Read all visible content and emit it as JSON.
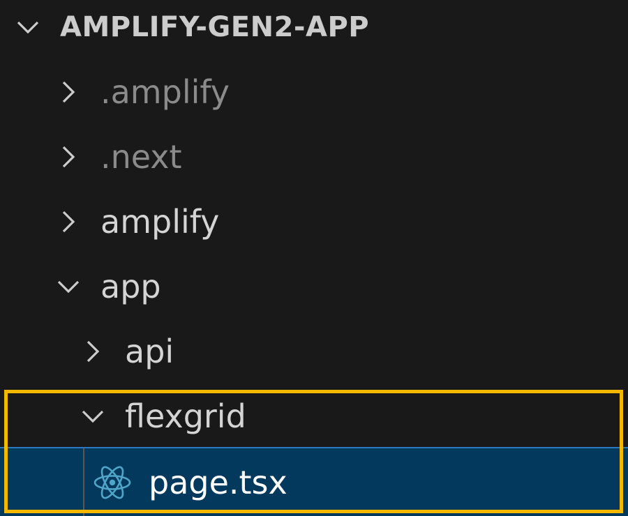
{
  "explorer": {
    "root": {
      "label": "AMPLIFY-GEN2-APP",
      "icon": "chevron-down-icon",
      "expanded": true
    },
    "items": [
      {
        "label": ".amplify",
        "icon": "chevron-right-icon",
        "expanded": false,
        "dimmed": true
      },
      {
        "label": ".next",
        "icon": "chevron-right-icon",
        "expanded": false,
        "dimmed": true
      },
      {
        "label": "amplify",
        "icon": "chevron-right-icon",
        "expanded": false,
        "dimmed": false
      },
      {
        "label": "app",
        "icon": "chevron-down-icon",
        "expanded": true,
        "dimmed": false
      },
      {
        "label": "api",
        "icon": "chevron-right-icon",
        "expanded": false,
        "dimmed": false
      },
      {
        "label": "flexgrid",
        "icon": "chevron-down-icon",
        "expanded": true,
        "dimmed": false
      },
      {
        "label": "page.tsx",
        "icon": "react-icon",
        "selected": true
      }
    ]
  },
  "colors": {
    "background": "#191919",
    "selection": "#04395e",
    "selection_border": "#2b79c2",
    "highlight": "#f5b800",
    "react_icon": "#4fa6c9",
    "dimmed_text": "#8b8b8b"
  }
}
